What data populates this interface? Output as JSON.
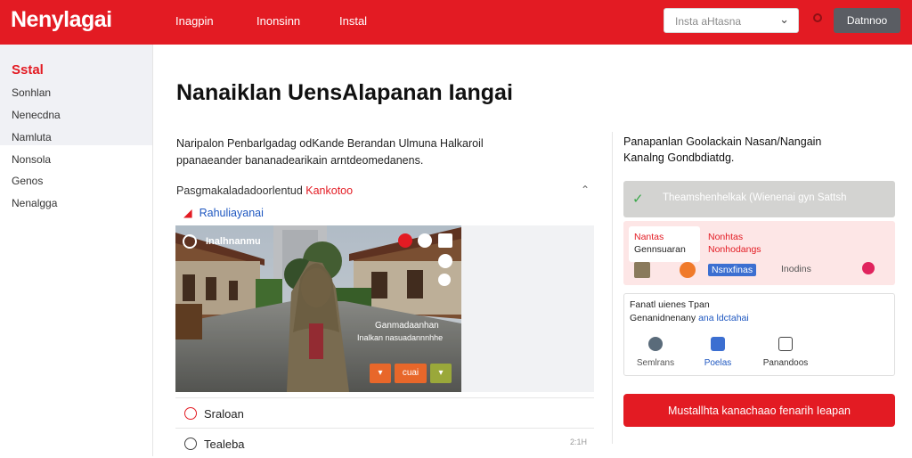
{
  "header": {
    "logo": "Nenylagai",
    "nav": [
      "Inagpin",
      "Inonsinn",
      "Instal"
    ],
    "select_value": "Insta aHtasna",
    "button_label": "Datnnoo"
  },
  "sidebar": {
    "title": "Sstal",
    "items": [
      "Sonhlan",
      "Nenecdna",
      "Namluta",
      "Nonsola",
      "Genos",
      "Nenalgga"
    ]
  },
  "main": {
    "title": "Nanaiklan UensAlapanan Iangai",
    "intro_line1": "Naripalon Penbarlgadag odKande Berandan Ulmuna Halkaroil",
    "intro_line2": "ppanaeander bananadearikain arntdeomedanens.",
    "section_text": "Pasgmakaladadoorlentud",
    "section_accent": "Kankotoo",
    "pin_label": "Rahuliayanai",
    "photo": {
      "label": "Inalhnanmu",
      "caption1": "Ganmadaanhan",
      "caption2": "Inalkan nasuadannnhhe",
      "btn_mid": "cuai"
    },
    "list": [
      {
        "label": "Sraloan",
        "meta": ""
      },
      {
        "label": "Tealeba",
        "meta": "2:1H"
      }
    ]
  },
  "right": {
    "intro_line1": "Panapanlan Goolackain Nasan/Nangain",
    "intro_line2": "Kanalng Gondbdiatdg.",
    "success_text": "Theamshenhelkak (Wienenai gyn Sattsh",
    "pink": {
      "c1": "Nantas",
      "c2": "Gennsuaran",
      "c3": "Nonhtas",
      "c4": "Nonhodangs",
      "blue": "Nsnxfinas",
      "gray": "Inodins"
    },
    "box": {
      "line1": "Fanatl uienes Tpan",
      "line2_a": "Genanidnenany",
      "line2_link": "ana ldctahai",
      "options": [
        "Semlrans",
        "Poelas",
        "Panandoos"
      ]
    },
    "cta": "Mustallhta kanachaao fenarih Ieapan"
  },
  "colors": {
    "brand_red": "#e31b23",
    "link_blue": "#1e57c0",
    "success_green": "#3aa84a"
  }
}
